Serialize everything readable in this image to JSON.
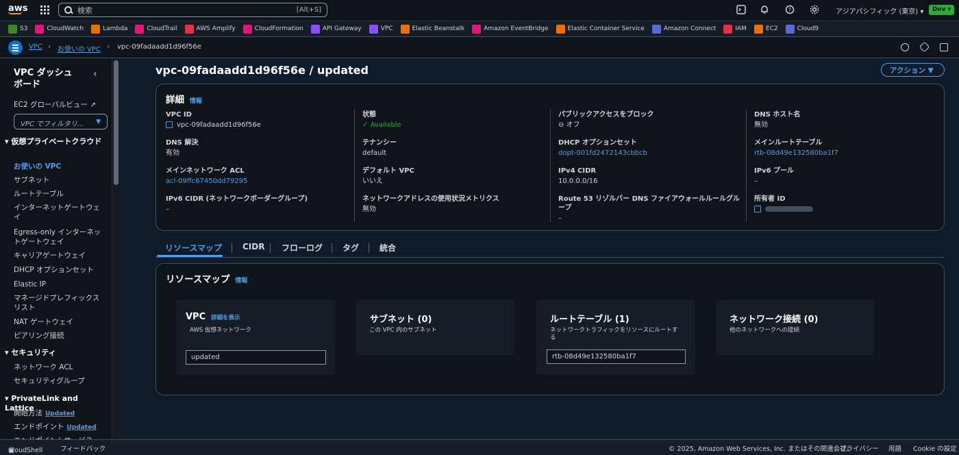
{
  "topnav": {
    "logo": "aws",
    "search_placeholder": "検索",
    "search_shortcut": "[Alt+S]",
    "region": "アジアパシフィック (東京) ▾",
    "account_badge": "Dev ▾",
    "icons": [
      "cloudshell-icon",
      "bell-icon",
      "help-icon",
      "gear-icon"
    ]
  },
  "favorites": [
    {
      "label": "S3",
      "color": "#3f8624"
    },
    {
      "label": "CloudWatch",
      "color": "#e7157b"
    },
    {
      "label": "Lambda",
      "color": "#ed7100"
    },
    {
      "label": "CloudTrail",
      "color": "#e7157b"
    },
    {
      "label": "AWS Amplify",
      "color": "#dd344c"
    },
    {
      "label": "CloudFormation",
      "color": "#e7157b"
    },
    {
      "label": "API Gateway",
      "color": "#8c4fff"
    },
    {
      "label": "VPC",
      "color": "#8c4fff"
    },
    {
      "label": "Elastic Beanstalk",
      "color": "#ed7100"
    },
    {
      "label": "Amazon EventBridge",
      "color": "#e7157b"
    },
    {
      "label": "Elastic Container Service",
      "color": "#ed7100"
    },
    {
      "label": "Amazon Connect",
      "color": "#5a6bd8"
    },
    {
      "label": "IAM",
      "color": "#dd344c"
    },
    {
      "label": "EC2",
      "color": "#ed7100"
    },
    {
      "label": "Cloud9",
      "color": "#5a6bd8"
    }
  ],
  "breadcrumb": {
    "root": "VPC",
    "parent": "お使いの VPC",
    "current": "vpc-09fadaadd1d96f56e"
  },
  "sidebar": {
    "title": "VPC ダッシュボード",
    "global_view": "EC2 グローバルビュー",
    "filter_placeholder": "VPC でフィルタリ...",
    "section1": "仮想プライベートクラウド",
    "items1": [
      "お使いの VPC",
      "サブネット",
      "ルートテーブル",
      "インターネットゲートウェイ",
      "Egress-only インターネットゲートウェイ",
      "キャリアゲートウェイ",
      "DHCP オプションセット",
      "Elastic IP",
      "マネージドプレフィックスリスト",
      "NAT ゲートウェイ",
      "ピアリング接続"
    ],
    "section2": "セキュリティ",
    "items2": [
      "ネットワーク ACL",
      "セキュリティグループ"
    ],
    "section3": "PrivateLink and Lattice",
    "items3": [
      "開始方法",
      "エンドポイント",
      "エンドポイントサービス"
    ],
    "updated_badge": "Updated"
  },
  "page": {
    "title": "vpc-09fadaadd1d96f56e / updated",
    "actions": "アクション"
  },
  "details": {
    "header": "詳細",
    "info": "情報",
    "col1": [
      {
        "k": "VPC ID",
        "v": "vpc-09fadaadd1d96f56e"
      },
      {
        "k": "DNS 解決",
        "v": "有効"
      },
      {
        "k": "メインネットワーク ACL",
        "v": "acl-09ffc67450dd79295"
      },
      {
        "k": "IPv6 CIDR (ネットワークボーダーグループ)",
        "v": "–"
      }
    ],
    "col2": [
      {
        "k": "状態",
        "v": "Available"
      },
      {
        "k": "テナンシー",
        "v": "default"
      },
      {
        "k": "デフォルト VPC",
        "v": "いいえ"
      },
      {
        "k": "ネットワークアドレスの使用状況メトリクス",
        "v": "無効"
      }
    ],
    "col3": [
      {
        "k": "パブリックアクセスをブロック",
        "v": "オフ"
      },
      {
        "k": "DHCP オプションセット",
        "v": "dopt-001fd2472143cbbcb"
      },
      {
        "k": "IPv4 CIDR",
        "v": "10.0.0.0/16"
      },
      {
        "k": "Route 53 リゾルバー DNS ファイアウォールルールグループ",
        "v": "–"
      }
    ],
    "col4": [
      {
        "k": "DNS ホスト名",
        "v": "無効"
      },
      {
        "k": "メインルートテーブル",
        "v": "rtb-08d49e132580ba1f7"
      },
      {
        "k": "IPv6 プール",
        "v": "–"
      },
      {
        "k": "所有者 ID",
        "v": ""
      }
    ]
  },
  "tabs": [
    "リソースマップ",
    "CIDR",
    "フローログ",
    "タグ",
    "統合"
  ],
  "resource_map": {
    "header": "リソースマップ",
    "info": "情報",
    "vpc": {
      "title": "VPC",
      "link": "詳細を表示",
      "sub": "AWS 仮想ネットワーク",
      "field": "updated"
    },
    "subnets": {
      "title": "サブネット (0)",
      "sub": "この VPC 内のサブネット"
    },
    "route_tables": {
      "title": "ルートテーブル (1)",
      "sub": "ネットワークトラフィックをリソースにルートする",
      "field": "rtb-08d49e132580ba1f7"
    },
    "network": {
      "title": "ネットワーク接続 (0)",
      "sub": "他のネットワークへの接続"
    }
  },
  "footer": {
    "cloudshell": "CloudShell",
    "feedback": "フィードバック",
    "copyright": "© 2025, Amazon Web Services, Inc. またはその関連会社。",
    "privacy": "プライバシー",
    "terms": "用語",
    "cookies": "Cookie の設定"
  }
}
